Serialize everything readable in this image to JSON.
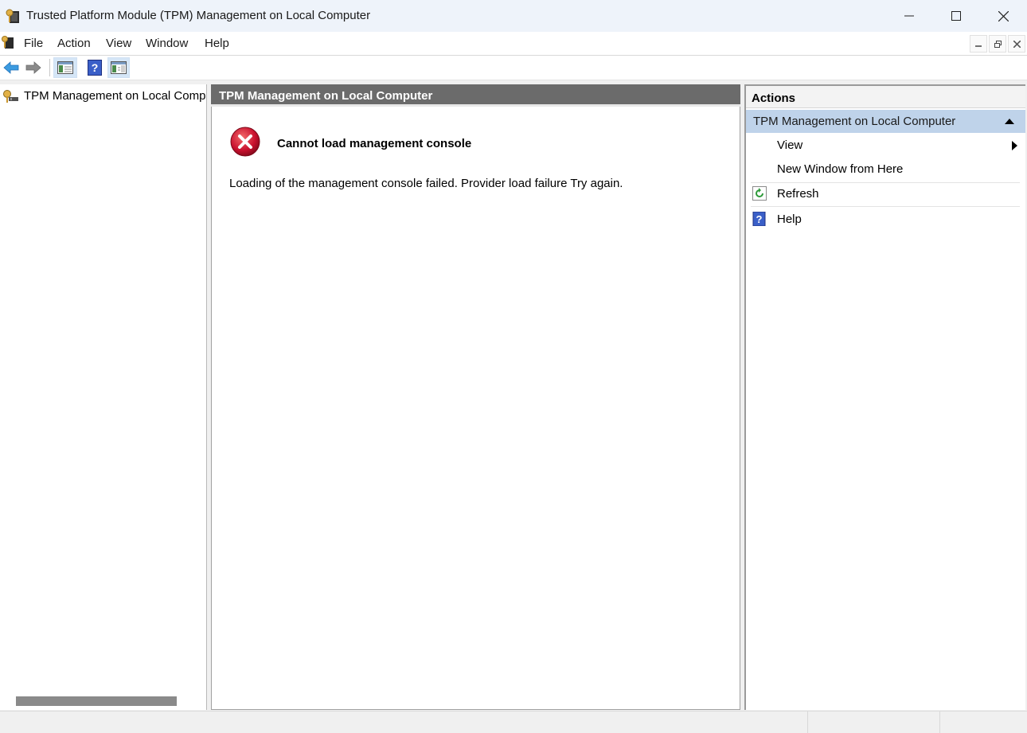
{
  "window": {
    "title": "Trusted Platform Module (TPM) Management on Local Computer",
    "icon": "tpm-key-icon",
    "controls": [
      "minimize-icon",
      "maximize-icon",
      "close-icon"
    ]
  },
  "menu": {
    "items": [
      "File",
      "Action",
      "View",
      "Window",
      "Help"
    ]
  },
  "toolbar": {
    "buttons": [
      "back-arrow-icon",
      "forward-arrow-icon",
      "show-hide-console-tree-icon",
      "help-icon",
      "show-hide-action-pane-icon"
    ]
  },
  "tree": {
    "root_label": "TPM Management on Local Computer"
  },
  "center": {
    "header": "TPM Management on Local Computer",
    "error_title": "Cannot load management console",
    "error_message": "Loading of the management console failed. Provider load failure  Try again."
  },
  "actions": {
    "header": "Actions",
    "group": "TPM Management on Local Computer",
    "items": [
      {
        "label": "View",
        "icon": null,
        "submenu": true
      },
      {
        "label": "New Window from Here",
        "icon": null
      },
      {
        "label": "Refresh",
        "icon": "refresh-icon"
      },
      {
        "label": "Help",
        "icon": "help-icon"
      }
    ]
  },
  "colors": {
    "title_bar": "#eef3fa",
    "center_header": "#6b6b6b",
    "actions_group": "#bfd3ea",
    "error_red": "#c8102e"
  }
}
